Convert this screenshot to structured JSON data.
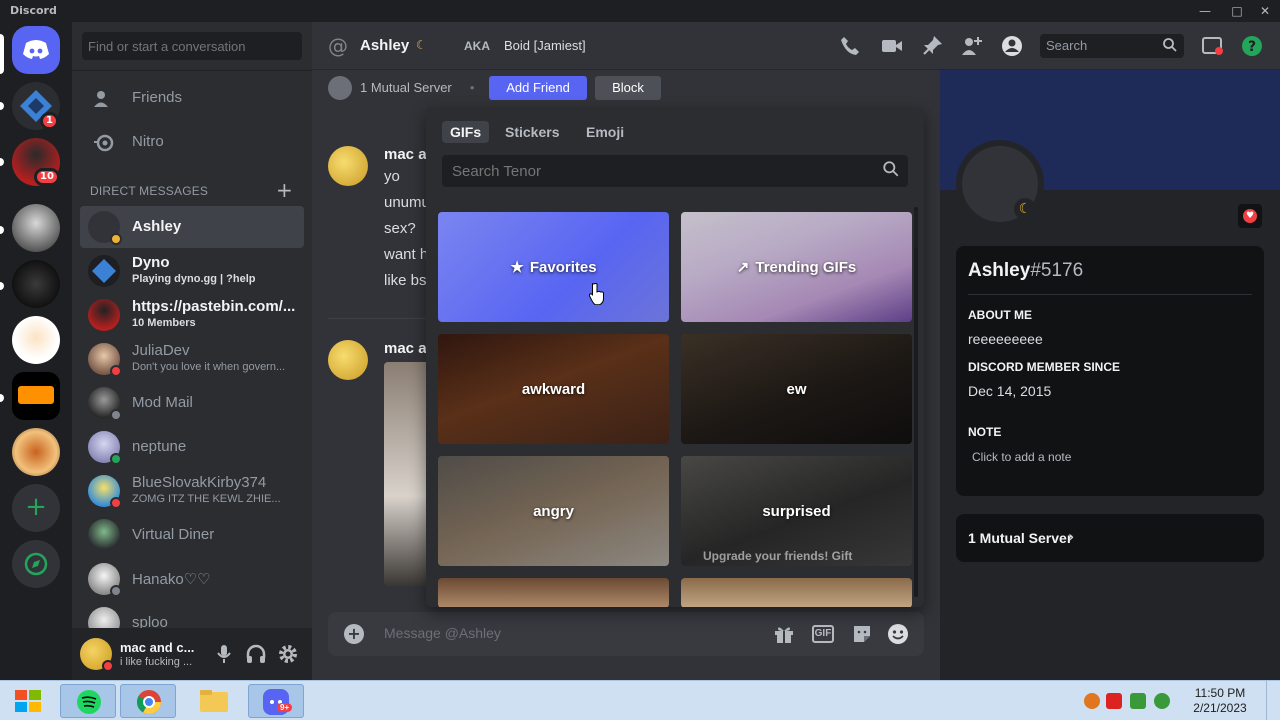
{
  "window": {
    "app_title": "Discord"
  },
  "rail": {
    "badges": [
      "1",
      "10"
    ],
    "add_server_icon": "plus-icon",
    "explore_icon": "compass-icon"
  },
  "sidebar": {
    "search_placeholder": "Find or start a conversation",
    "nav": [
      {
        "label": "Friends",
        "icon": "friends-icon"
      },
      {
        "label": "Nitro",
        "icon": "nitro-icon"
      }
    ],
    "dm_header": "DIRECT MESSAGES",
    "dm_add": "+",
    "dms": [
      {
        "name": "Ashley",
        "sub": "",
        "status": "idle"
      },
      {
        "name": "Dyno",
        "sub": "Playing dyno.gg | ?help",
        "status": "none"
      },
      {
        "name": "https://pastebin.com/...",
        "sub": "10 Members",
        "status": "none"
      },
      {
        "name": "JuliaDev",
        "sub": "Don't you love it when govern...",
        "status": "dnd"
      },
      {
        "name": "Mod Mail",
        "sub": "",
        "status": "offline"
      },
      {
        "name": "neptune",
        "sub": "",
        "status": "online"
      },
      {
        "name": "BlueSlovakKirby374",
        "sub": "ZOMG ITZ THE KEWL ZHIE...",
        "status": "dnd"
      },
      {
        "name": "Virtual Diner",
        "sub": "",
        "status": "none"
      },
      {
        "name": "Hanako♡♡",
        "sub": "",
        "status": "offline"
      },
      {
        "name": "sploo",
        "sub": "",
        "status": "offline"
      }
    ]
  },
  "user_panel": {
    "name": "mac and c...",
    "status": "i like fucking ..."
  },
  "header": {
    "title": "Ashley",
    "aka_label": "AKA",
    "aka_value": "Boid [Jamiest]",
    "search_placeholder": "Search"
  },
  "chat": {
    "mutual_text": "1 Mutual Server",
    "dot": "•",
    "add_friend": "Add Friend",
    "block": "Block",
    "messages": [
      {
        "author": "mac a",
        "lines": [
          "yo",
          "unumu",
          "sex?",
          "want h",
          "like bs"
        ]
      },
      {
        "author": "mac a",
        "lines": []
      }
    ],
    "composer_placeholder": "Message @Ashley",
    "gif_label": "GIF"
  },
  "picker": {
    "tabs": [
      "GIFs",
      "Stickers",
      "Emoji"
    ],
    "search_placeholder": "Search Tenor",
    "tiles": [
      {
        "label": "Favorites",
        "icon": "star-icon"
      },
      {
        "label": "Trending GIFs",
        "icon": "trending-icon"
      },
      {
        "label": "awkward"
      },
      {
        "label": "ew"
      },
      {
        "label": "angry"
      },
      {
        "label": "surprised"
      }
    ],
    "nitro_note": "Upgrade your friends! Gift them awesome chat perks with Nitro."
  },
  "profile": {
    "name": "Ashley",
    "discriminator": "#5176",
    "about_label": "ABOUT ME",
    "about_value": "reeeeeeeee",
    "since_label": "DISCORD MEMBER SINCE",
    "since_value": "Dec 14, 2015",
    "note_label": "NOTE",
    "note_placeholder": "Click to add a note",
    "mutual": "1 Mutual Server"
  },
  "taskbar": {
    "time": "11:50 PM",
    "date": "2/21/2023",
    "discord_badge": "9+"
  },
  "colors": {
    "blurple": "#5865f2",
    "danger": "#f23f43",
    "idle": "#f0b232",
    "online": "#23a55a",
    "offline": "#80848e"
  }
}
